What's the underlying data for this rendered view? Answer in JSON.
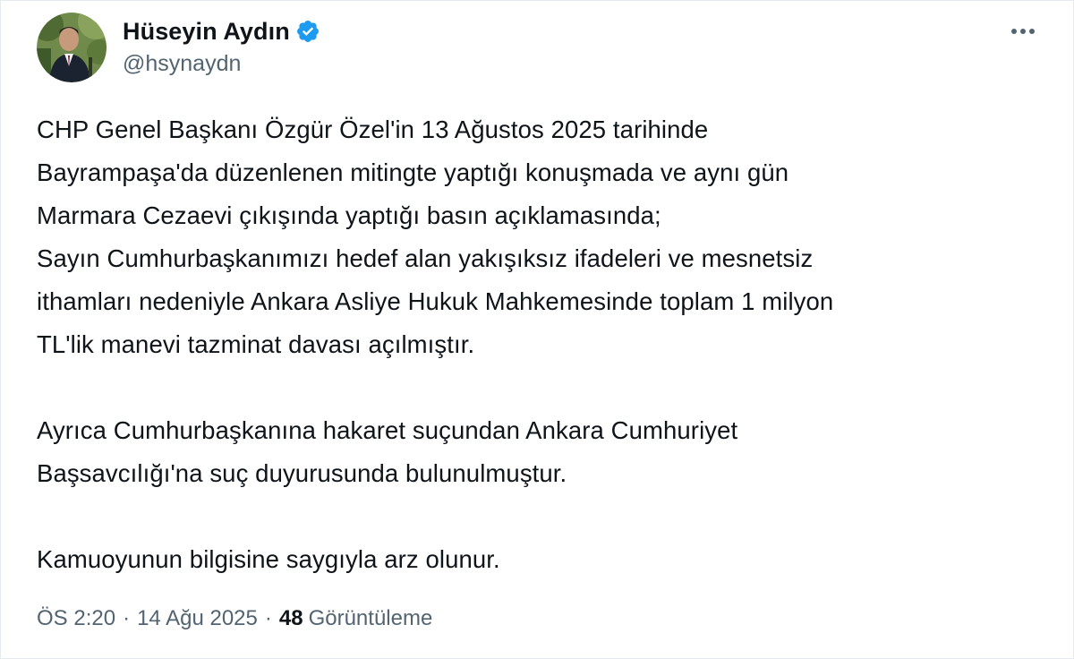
{
  "author": {
    "display_name": "Hüseyin Aydın",
    "handle": "@hsynaydn",
    "verified_icon": "verified-badge-icon",
    "avatar_icon": "profile-photo"
  },
  "menu": {
    "more_icon": "more-horizontal-icon"
  },
  "tweet": {
    "lines": [
      "CHP Genel Başkanı Özgür Özel'in 13 Ağustos 2025 tarihinde",
      "Bayrampaşa'da düzenlenen mitingte yaptığı konuşmada ve aynı gün",
      "Marmara Cezaevi çıkışında yaptığı basın açıklamasında;",
      "Sayın Cumhurbaşkanımızı hedef alan yakışıksız ifadeleri ve mesnetsiz",
      "ithamları nedeniyle Ankara Asliye Hukuk Mahkemesinde toplam 1 milyon",
      "TL'lik manevi tazminat davası açılmıştır.",
      "Ayrıca Cumhurbaşkanına hakaret suçundan Ankara Cumhuriyet",
      "Başsavcılığı'na suç duyurusunda bulunulmuştur.",
      "Kamuoyunun bilgisine saygıyla arz olunur."
    ]
  },
  "meta": {
    "time": "ÖS 2:20",
    "separator": "·",
    "date": "14 Ağu 2025",
    "views_count": "48",
    "views_label": "Görüntüleme"
  },
  "colors": {
    "text": "#0f1419",
    "secondary": "#536471",
    "verified": "#1d9bf0"
  }
}
